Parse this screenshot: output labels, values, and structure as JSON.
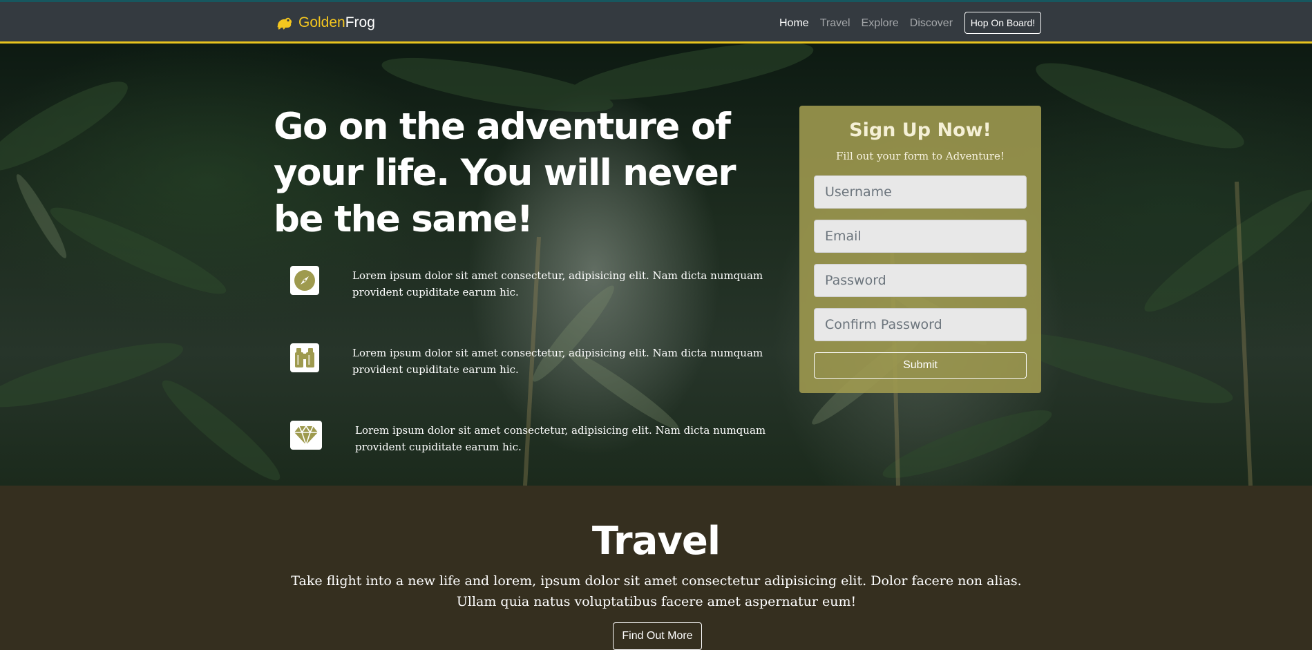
{
  "nav": {
    "brand_part1": "Golden",
    "brand_part2": "Frog",
    "links": [
      "Home",
      "Travel",
      "Explore",
      "Discover"
    ],
    "cta": "Hop On Board!"
  },
  "hero": {
    "title": "Go on the adventure of your life. You will never be the same!",
    "features": [
      {
        "icon": "compass-icon",
        "text": "Lorem ipsum dolor sit amet consectetur, adipisicing elit. Nam dicta numquam provident cupiditate earum hic."
      },
      {
        "icon": "binoculars-icon",
        "text": "Lorem ipsum dolor sit amet consectetur, adipisicing elit. Nam dicta numquam provident cupiditate earum hic."
      },
      {
        "icon": "diamond-icon",
        "text": "Lorem ipsum dolor sit amet consectetur, adipisicing elit. Nam dicta numquam provident cupiditate earum hic."
      }
    ]
  },
  "signup": {
    "title": "Sign Up Now!",
    "subtitle": "Fill out your form to Adventure!",
    "username_placeholder": "Username",
    "email_placeholder": "Email",
    "password_placeholder": "Password",
    "confirm_placeholder": "Confirm Password",
    "submit": "Submit"
  },
  "travel": {
    "title": "Travel",
    "text": "Take flight into a new life and lorem, ipsum dolor sit amet consectetur adipisicing elit. Dolor facere non alias. Ullam quia natus voluptatibus facere amet aspernatur eum!",
    "button": "Find Out More"
  },
  "colors": {
    "navbar": "#343a40",
    "accent_gold": "#e8c31e",
    "icon_olive": "#9e9a4e",
    "travel_bg": "#352f1f"
  }
}
